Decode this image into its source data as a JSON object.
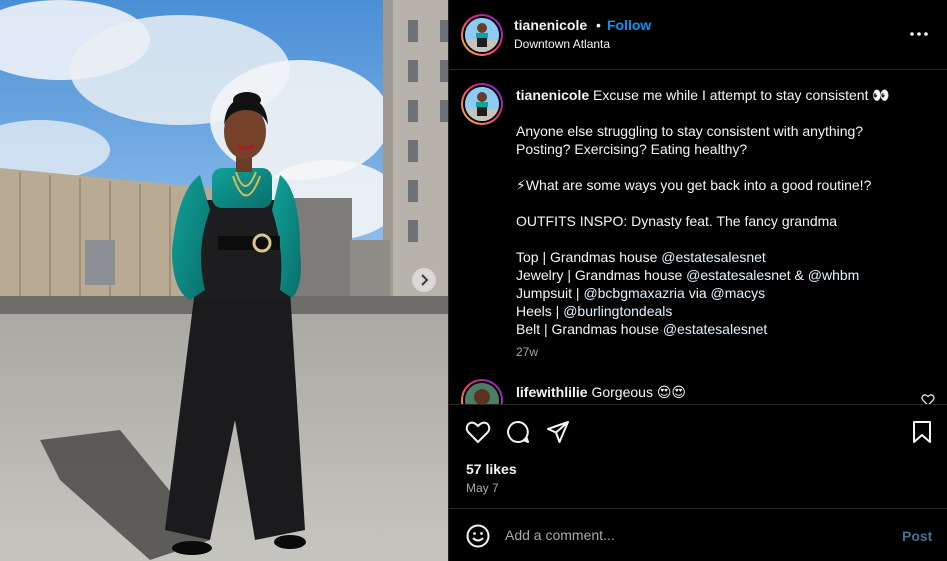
{
  "post": {
    "username": "tianenicole",
    "separator": "•",
    "follow_label": "Follow",
    "location": "Downtown Atlanta",
    "more_icon": "more-horizontal-icon"
  },
  "caption": {
    "username": "tianenicole",
    "line1": "Excuse me while I attempt to stay consistent 👀",
    "line2": "Anyone else struggling to stay consistent with anything?",
    "line3": "Posting? Exercising? Eating healthy?",
    "line4": "⚡What are some ways you get back into a good routine!?",
    "line5": "OUTFITS INSPO: Dynasty feat. The fancy grandma",
    "top_label": "Top | Grandmas house ",
    "top_mention": "@estatesalesnet",
    "jewelry_label": "Jewelry | Grandmas house ",
    "jewelry_mention1": "@estatesalesnet",
    "jewelry_amp": " & ",
    "jewelry_mention2": "@whbm",
    "jumpsuit_label": "Jumpsuit | ",
    "jumpsuit_mention1": "@bcbgmaxazria",
    "jumpsuit_via": " via ",
    "jumpsuit_mention2": "@macys",
    "heels_label": "Heels | ",
    "heels_mention": "@burlingtondeals",
    "belt_label": "Belt | Grandmas house ",
    "belt_mention": "@estatesalesnet",
    "age": "27w"
  },
  "comment": {
    "username": "lifewithlilie",
    "text": "Gorgeous 😍😍"
  },
  "actions": {
    "likes": "57 likes",
    "date": "May 7"
  },
  "add_comment": {
    "placeholder": "Add a comment...",
    "post_label": "Post"
  },
  "colors": {
    "link": "#0095f6",
    "background": "#000000",
    "secondary_text": "#a8a8a8"
  }
}
